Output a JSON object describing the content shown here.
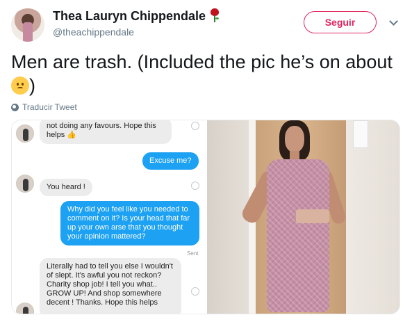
{
  "tweet": {
    "author_name": "Thea Lauryn Chippendale",
    "author_handle": "@theachippendale",
    "follow_label": "Seguir",
    "text": "Men are trash. (Included the pic he’s on about ",
    "text_end": ")",
    "translate_label": "Traducir Tweet"
  },
  "chat": {
    "messages": [
      {
        "direction": "in",
        "text": "not doing any favours. Hope this helps 👍"
      },
      {
        "direction": "out",
        "text": "Excuse me?"
      },
      {
        "direction": "in",
        "text": "You heard !"
      },
      {
        "direction": "out",
        "text": "Why did you feel like you needed to comment on it? Is your head that far up your own arse that you thought your opinion mattered?"
      },
      {
        "direction": "in",
        "text": "Literally had to tell you else I wouldn't of slept. It's awful you not reckon? Charity shop job! I tell you what.. GROW UP! And shop somewhere decent ! Thanks. Hope this helps"
      }
    ],
    "sent_label": "Sent"
  },
  "colors": {
    "accent": "#e0245e",
    "bubble_out": "#1da1f2",
    "bubble_in": "#ececec"
  },
  "icons": [
    "rose-icon",
    "chevron-down-icon",
    "upside-down-face-emoji-icon",
    "globe-icon",
    "heart-icon"
  ]
}
